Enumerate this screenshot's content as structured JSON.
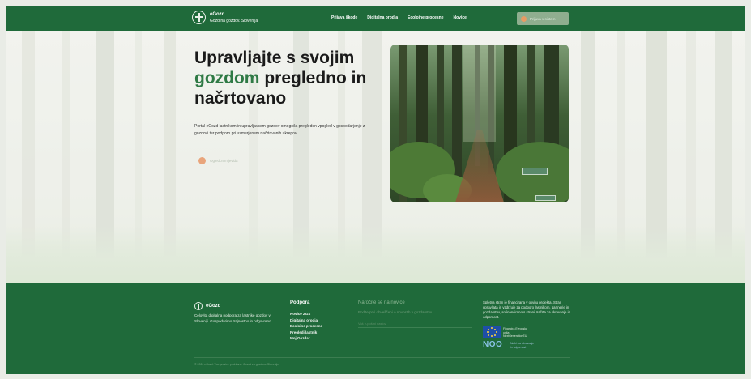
{
  "header": {
    "brand_name": "eGozd",
    "brand_subtitle": "Gozd na gozdov. Slovenija",
    "nav": [
      "Prijava škode",
      "Digitalna orodja",
      "Ecoloine procesne",
      "Novice"
    ],
    "cta_label": "Prijava v sistem"
  },
  "hero": {
    "title_line1": "Upravljajte s svojim",
    "title_accent": "gozdom",
    "title_rest": " pregledno in",
    "title_line3": "načrtovano",
    "description": "Portal eGozd lastnikom in upravljavcem gozdov omogoča pregleden vpogled v gospodarjenje z gozdovi ter podporo pri usmerjenem načrtovanih ukrepov.",
    "cta_label": "Ogled zemljevida"
  },
  "footer": {
    "brand_name": "eGozd",
    "about": "Celovita digitalna podpora za lastnike gozdov v Sloveniji. Gospodarimo trajnostno in odgovorno.",
    "support_heading": "Podpora",
    "support_links": [
      "Novice ZGS",
      "Digitalna orodja",
      "Ecoloine procesne",
      "Pregledi lastnik",
      "Moj Gozdar"
    ],
    "newsletter_heading": "Naročite se na novice",
    "newsletter_desc": "Bodite prvi obveščeni o novostih v gozdarstvu",
    "newsletter_placeholder": "Vaš e-poštni naslov",
    "funding_text": "Spletna stran je financirana v okviru projekta. Stran upravljata in vzdržuje za podporo lastnikom, partnerje in gozdarstvu, sofinancirano s strani Načrta za okrevanje in odpornost.",
    "eu_label": "Financira Evropska unija NextGenerationEU",
    "noo_label": "NOO",
    "noo_text": "Načrt za okrevanje in odpornost",
    "copyright": "© 2024 eGozd. Vse pravice pridržane. Zavod za gozdove Slovenije."
  },
  "colors": {
    "brand_green": "#1f6a3a",
    "accent_green": "#2f7a45",
    "cta_orange": "#e9a57c"
  }
}
